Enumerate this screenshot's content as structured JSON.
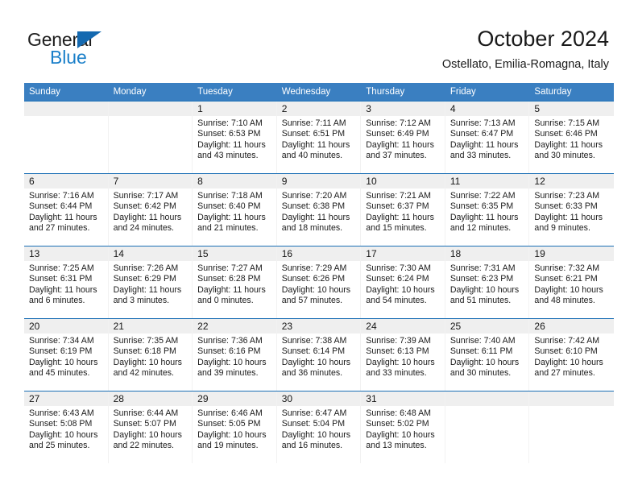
{
  "brand": {
    "name_top": "General",
    "name_bottom": "Blue",
    "triangle_color": "#1469b0",
    "blue_color": "#1a7fc9"
  },
  "header": {
    "title": "October 2024",
    "subtitle": "Ostellato, Emilia-Romagna, Italy",
    "weekday_header_bg": "#3a7fc1",
    "weekday_header_fg": "#ffffff",
    "week_divider_color": "#1a6fb5",
    "daynum_band_bg": "#efefef"
  },
  "weekdays": [
    "Sunday",
    "Monday",
    "Tuesday",
    "Wednesday",
    "Thursday",
    "Friday",
    "Saturday"
  ],
  "weeks": [
    [
      {
        "day": "",
        "sunrise": "",
        "sunset": "",
        "daylight_line1": "",
        "daylight_line2": ""
      },
      {
        "day": "",
        "sunrise": "",
        "sunset": "",
        "daylight_line1": "",
        "daylight_line2": ""
      },
      {
        "day": "1",
        "sunrise": "Sunrise: 7:10 AM",
        "sunset": "Sunset: 6:53 PM",
        "daylight_line1": "Daylight: 11 hours",
        "daylight_line2": "and 43 minutes."
      },
      {
        "day": "2",
        "sunrise": "Sunrise: 7:11 AM",
        "sunset": "Sunset: 6:51 PM",
        "daylight_line1": "Daylight: 11 hours",
        "daylight_line2": "and 40 minutes."
      },
      {
        "day": "3",
        "sunrise": "Sunrise: 7:12 AM",
        "sunset": "Sunset: 6:49 PM",
        "daylight_line1": "Daylight: 11 hours",
        "daylight_line2": "and 37 minutes."
      },
      {
        "day": "4",
        "sunrise": "Sunrise: 7:13 AM",
        "sunset": "Sunset: 6:47 PM",
        "daylight_line1": "Daylight: 11 hours",
        "daylight_line2": "and 33 minutes."
      },
      {
        "day": "5",
        "sunrise": "Sunrise: 7:15 AM",
        "sunset": "Sunset: 6:46 PM",
        "daylight_line1": "Daylight: 11 hours",
        "daylight_line2": "and 30 minutes."
      }
    ],
    [
      {
        "day": "6",
        "sunrise": "Sunrise: 7:16 AM",
        "sunset": "Sunset: 6:44 PM",
        "daylight_line1": "Daylight: 11 hours",
        "daylight_line2": "and 27 minutes."
      },
      {
        "day": "7",
        "sunrise": "Sunrise: 7:17 AM",
        "sunset": "Sunset: 6:42 PM",
        "daylight_line1": "Daylight: 11 hours",
        "daylight_line2": "and 24 minutes."
      },
      {
        "day": "8",
        "sunrise": "Sunrise: 7:18 AM",
        "sunset": "Sunset: 6:40 PM",
        "daylight_line1": "Daylight: 11 hours",
        "daylight_line2": "and 21 minutes."
      },
      {
        "day": "9",
        "sunrise": "Sunrise: 7:20 AM",
        "sunset": "Sunset: 6:38 PM",
        "daylight_line1": "Daylight: 11 hours",
        "daylight_line2": "and 18 minutes."
      },
      {
        "day": "10",
        "sunrise": "Sunrise: 7:21 AM",
        "sunset": "Sunset: 6:37 PM",
        "daylight_line1": "Daylight: 11 hours",
        "daylight_line2": "and 15 minutes."
      },
      {
        "day": "11",
        "sunrise": "Sunrise: 7:22 AM",
        "sunset": "Sunset: 6:35 PM",
        "daylight_line1": "Daylight: 11 hours",
        "daylight_line2": "and 12 minutes."
      },
      {
        "day": "12",
        "sunrise": "Sunrise: 7:23 AM",
        "sunset": "Sunset: 6:33 PM",
        "daylight_line1": "Daylight: 11 hours",
        "daylight_line2": "and 9 minutes."
      }
    ],
    [
      {
        "day": "13",
        "sunrise": "Sunrise: 7:25 AM",
        "sunset": "Sunset: 6:31 PM",
        "daylight_line1": "Daylight: 11 hours",
        "daylight_line2": "and 6 minutes."
      },
      {
        "day": "14",
        "sunrise": "Sunrise: 7:26 AM",
        "sunset": "Sunset: 6:29 PM",
        "daylight_line1": "Daylight: 11 hours",
        "daylight_line2": "and 3 minutes."
      },
      {
        "day": "15",
        "sunrise": "Sunrise: 7:27 AM",
        "sunset": "Sunset: 6:28 PM",
        "daylight_line1": "Daylight: 11 hours",
        "daylight_line2": "and 0 minutes."
      },
      {
        "day": "16",
        "sunrise": "Sunrise: 7:29 AM",
        "sunset": "Sunset: 6:26 PM",
        "daylight_line1": "Daylight: 10 hours",
        "daylight_line2": "and 57 minutes."
      },
      {
        "day": "17",
        "sunrise": "Sunrise: 7:30 AM",
        "sunset": "Sunset: 6:24 PM",
        "daylight_line1": "Daylight: 10 hours",
        "daylight_line2": "and 54 minutes."
      },
      {
        "day": "18",
        "sunrise": "Sunrise: 7:31 AM",
        "sunset": "Sunset: 6:23 PM",
        "daylight_line1": "Daylight: 10 hours",
        "daylight_line2": "and 51 minutes."
      },
      {
        "day": "19",
        "sunrise": "Sunrise: 7:32 AM",
        "sunset": "Sunset: 6:21 PM",
        "daylight_line1": "Daylight: 10 hours",
        "daylight_line2": "and 48 minutes."
      }
    ],
    [
      {
        "day": "20",
        "sunrise": "Sunrise: 7:34 AM",
        "sunset": "Sunset: 6:19 PM",
        "daylight_line1": "Daylight: 10 hours",
        "daylight_line2": "and 45 minutes."
      },
      {
        "day": "21",
        "sunrise": "Sunrise: 7:35 AM",
        "sunset": "Sunset: 6:18 PM",
        "daylight_line1": "Daylight: 10 hours",
        "daylight_line2": "and 42 minutes."
      },
      {
        "day": "22",
        "sunrise": "Sunrise: 7:36 AM",
        "sunset": "Sunset: 6:16 PM",
        "daylight_line1": "Daylight: 10 hours",
        "daylight_line2": "and 39 minutes."
      },
      {
        "day": "23",
        "sunrise": "Sunrise: 7:38 AM",
        "sunset": "Sunset: 6:14 PM",
        "daylight_line1": "Daylight: 10 hours",
        "daylight_line2": "and 36 minutes."
      },
      {
        "day": "24",
        "sunrise": "Sunrise: 7:39 AM",
        "sunset": "Sunset: 6:13 PM",
        "daylight_line1": "Daylight: 10 hours",
        "daylight_line2": "and 33 minutes."
      },
      {
        "day": "25",
        "sunrise": "Sunrise: 7:40 AM",
        "sunset": "Sunset: 6:11 PM",
        "daylight_line1": "Daylight: 10 hours",
        "daylight_line2": "and 30 minutes."
      },
      {
        "day": "26",
        "sunrise": "Sunrise: 7:42 AM",
        "sunset": "Sunset: 6:10 PM",
        "daylight_line1": "Daylight: 10 hours",
        "daylight_line2": "and 27 minutes."
      }
    ],
    [
      {
        "day": "27",
        "sunrise": "Sunrise: 6:43 AM",
        "sunset": "Sunset: 5:08 PM",
        "daylight_line1": "Daylight: 10 hours",
        "daylight_line2": "and 25 minutes."
      },
      {
        "day": "28",
        "sunrise": "Sunrise: 6:44 AM",
        "sunset": "Sunset: 5:07 PM",
        "daylight_line1": "Daylight: 10 hours",
        "daylight_line2": "and 22 minutes."
      },
      {
        "day": "29",
        "sunrise": "Sunrise: 6:46 AM",
        "sunset": "Sunset: 5:05 PM",
        "daylight_line1": "Daylight: 10 hours",
        "daylight_line2": "and 19 minutes."
      },
      {
        "day": "30",
        "sunrise": "Sunrise: 6:47 AM",
        "sunset": "Sunset: 5:04 PM",
        "daylight_line1": "Daylight: 10 hours",
        "daylight_line2": "and 16 minutes."
      },
      {
        "day": "31",
        "sunrise": "Sunrise: 6:48 AM",
        "sunset": "Sunset: 5:02 PM",
        "daylight_line1": "Daylight: 10 hours",
        "daylight_line2": "and 13 minutes."
      },
      {
        "day": "",
        "sunrise": "",
        "sunset": "",
        "daylight_line1": "",
        "daylight_line2": ""
      },
      {
        "day": "",
        "sunrise": "",
        "sunset": "",
        "daylight_line1": "",
        "daylight_line2": ""
      }
    ]
  ]
}
